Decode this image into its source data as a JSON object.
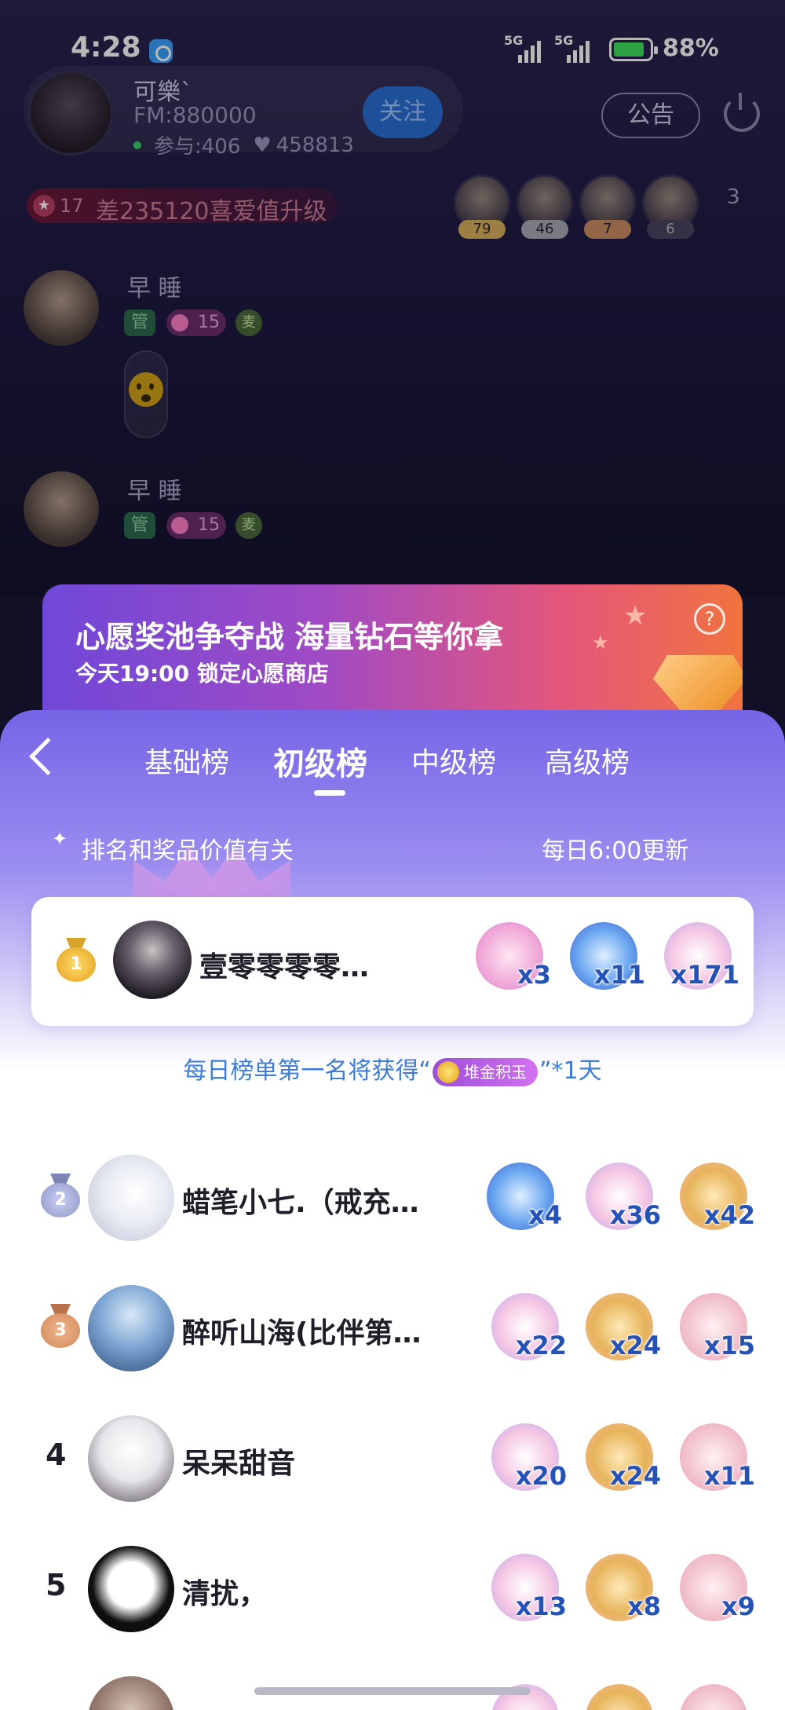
{
  "status_bar": {
    "time": "4:28",
    "network1": "5G",
    "network2": "5G",
    "battery": "88%"
  },
  "room": {
    "host": {
      "name": "可樂`",
      "fm": "FM:880000",
      "participants": "参与:406",
      "hearts": "458813"
    },
    "follow_label": "关注",
    "notice_label": "公告",
    "level": {
      "number": "17",
      "text": "差235120喜爱值升级"
    },
    "fans": [
      {
        "score": "79"
      },
      {
        "score": "46"
      },
      {
        "score": "7"
      },
      {
        "score": "6"
      }
    ],
    "fans_more": "3",
    "chat": [
      {
        "name": "早 睡",
        "badge_guan": "管",
        "badge_level": "15",
        "badge_speak": "麦"
      },
      {
        "name": "早 睡",
        "badge_guan": "管",
        "badge_level": "15",
        "badge_speak": "麦"
      }
    ]
  },
  "banner": {
    "title": "心愿奖池争夺战 海量钻石等你拿",
    "subtitle": "今天19:00 锁定心愿商店",
    "help": "?"
  },
  "leaderboard": {
    "tabs": [
      "基础榜",
      "初级榜",
      "中级榜",
      "高级榜"
    ],
    "active_tab": "初级榜",
    "hint_left": "排名和奖品价值有关",
    "hint_right": "每日6:00更新",
    "reward_prefix": "每日榜单第一名将获得“",
    "reward_chip": "堆金积玉",
    "reward_suffix": "”*1天",
    "entries": [
      {
        "rank": "1",
        "name": "壹零零零零零零",
        "gifts": [
          {
            "icon": "ferris-wheel-gift-icon",
            "count": "x3"
          },
          {
            "icon": "crystal-ball-gift-icon",
            "count": "x11"
          },
          {
            "icon": "carousel-gift-icon",
            "count": "x171"
          }
        ]
      },
      {
        "rank": "2",
        "name": "蜡笔小七.（戒充…",
        "gifts": [
          {
            "icon": "crystal-ball-gift-icon",
            "count": "x4"
          },
          {
            "icon": "carousel-gift-icon",
            "count": "x36"
          },
          {
            "icon": "gold-ingot-gift-icon",
            "count": "x42"
          }
        ]
      },
      {
        "rank": "3",
        "name": "醉听山海(比伴第…",
        "gifts": [
          {
            "icon": "carousel-gift-icon",
            "count": "x22"
          },
          {
            "icon": "gold-ingot-gift-icon",
            "count": "x24"
          },
          {
            "icon": "umbrella-gift-icon",
            "count": "x15"
          }
        ]
      },
      {
        "rank": "4",
        "name": "呆呆甜音",
        "gifts": [
          {
            "icon": "carousel-gift-icon",
            "count": "x20"
          },
          {
            "icon": "gold-ingot-gift-icon",
            "count": "x24"
          },
          {
            "icon": "umbrella-gift-icon",
            "count": "x11"
          }
        ]
      },
      {
        "rank": "5",
        "name": "清扰，",
        "gifts": [
          {
            "icon": "carousel-gift-icon",
            "count": "x13"
          },
          {
            "icon": "gold-ingot-gift-icon",
            "count": "x8"
          },
          {
            "icon": "umbrella-gift-icon",
            "count": "x9"
          }
        ]
      }
    ]
  },
  "colors": {
    "sheet_top": "#7565e6",
    "count_text": "#2452b6",
    "reward_text": "#3d7cd8",
    "gold_medal": "#e9b23a",
    "silver_medal": "#8e96c8",
    "bronze_medal": "#cf8a5a"
  }
}
